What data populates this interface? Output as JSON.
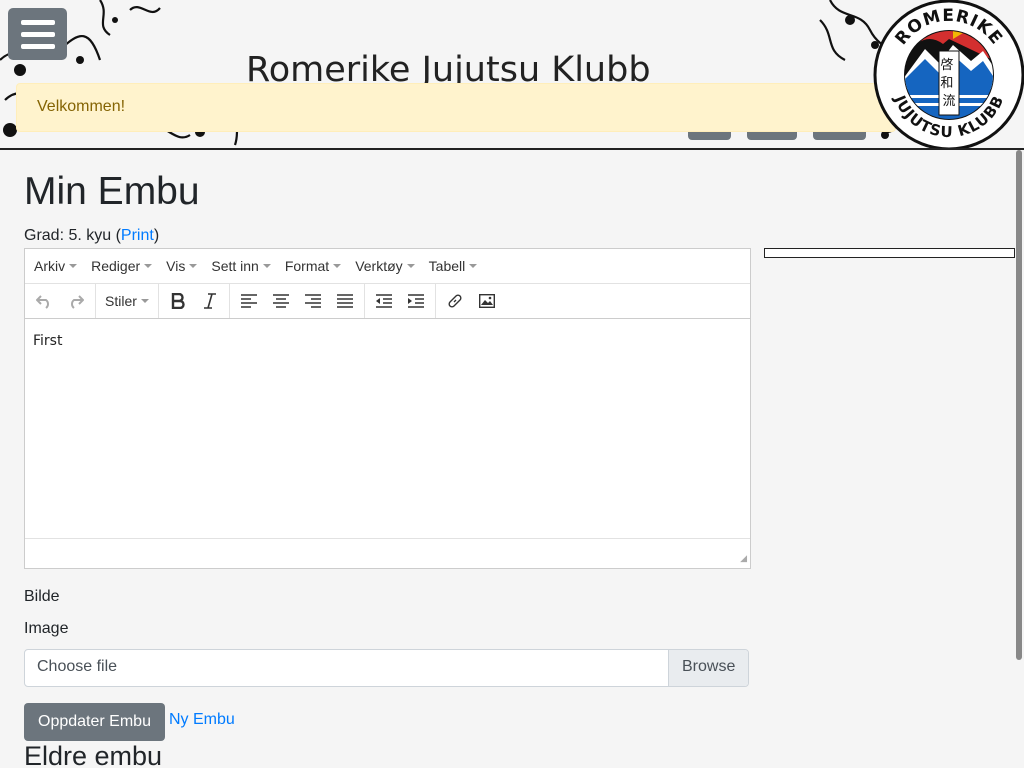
{
  "header": {
    "site_title": "Romerike Jujutsu Klubb",
    "alert": "Velkommen!",
    "logo": {
      "top_text": "ROMERIKE",
      "bottom_text": "JUJUTSU KLUBB",
      "kanji": [
        "啓",
        "和",
        "流"
      ]
    }
  },
  "main": {
    "title": "Min Embu",
    "grade_prefix": "Grad: 5. kyu (",
    "grade_link": "Print",
    "grade_suffix": ")"
  },
  "editor": {
    "menus": [
      "Arkiv",
      "Rediger",
      "Vis",
      "Sett inn",
      "Format",
      "Verktøy",
      "Tabell"
    ],
    "styles_label": "Stiler",
    "content": "First"
  },
  "form": {
    "label_bilde": "Bilde",
    "label_image": "Image",
    "file_placeholder": "Choose file",
    "browse_label": "Browse",
    "submit_label": "Oppdater Embu",
    "new_link": "Ny Embu"
  },
  "older_heading": "Eldre embu",
  "colors": {
    "primary_link": "#007bff",
    "secondary_button": "#6c757d",
    "alert_bg": "#fff3cd",
    "alert_text": "#856404",
    "logo_red": "#d32f2f",
    "logo_yellow": "#f2b705",
    "logo_blue": "#1565c0"
  }
}
